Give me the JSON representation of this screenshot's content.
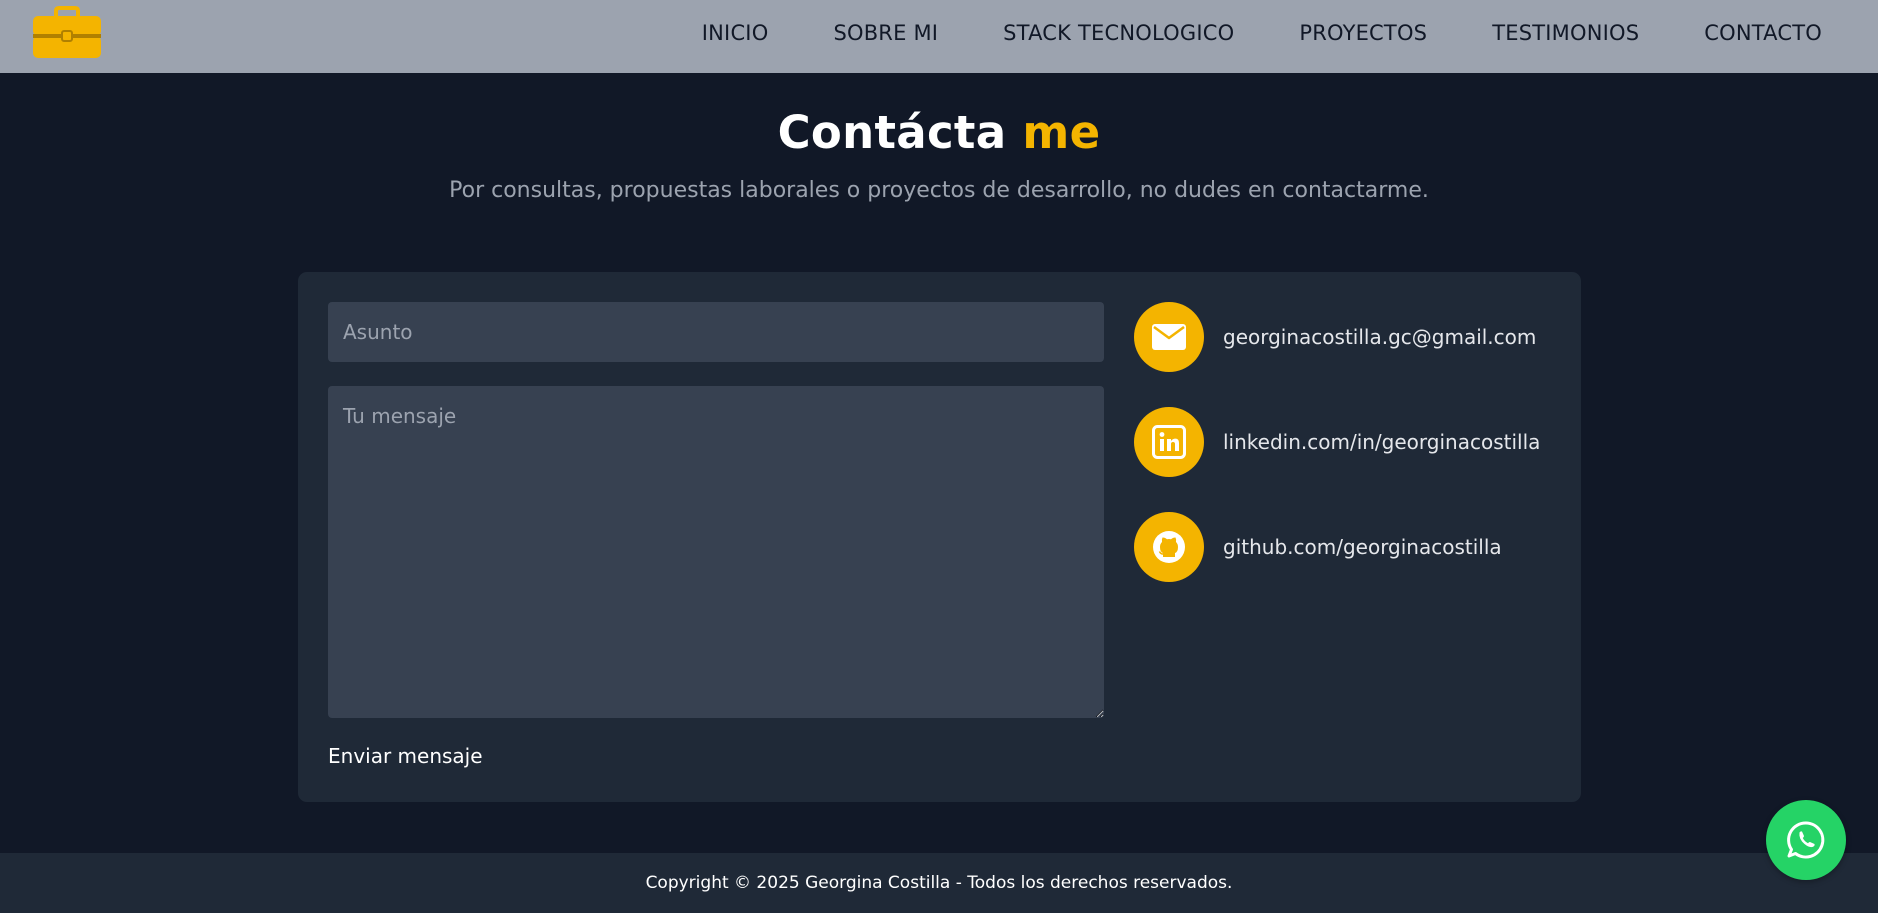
{
  "nav": {
    "items": [
      {
        "label": "INICIO"
      },
      {
        "label": "SOBRE MI"
      },
      {
        "label": "STACK TECNOLOGICO"
      },
      {
        "label": "PROYECTOS"
      },
      {
        "label": "TESTIMONIOS"
      },
      {
        "label": "CONTACTO"
      }
    ]
  },
  "header": {
    "title_main": "Contácta",
    "title_accent": "me",
    "subtitle": "Por consultas, propuestas laborales o proyectos de desarrollo, no dudes en contactarme."
  },
  "form": {
    "subject_placeholder": "Asunto",
    "subject_value": "",
    "message_placeholder": "Tu mensaje",
    "message_value": "",
    "send_label": "Enviar mensaje"
  },
  "contact": {
    "email": "georginacostilla.gc@gmail.com",
    "linkedin": "linkedin.com/in/georginacostilla",
    "github": "github.com/georginacostilla"
  },
  "footer": {
    "text": "Copyright © 2025 Georgina Costilla - Todos los derechos reservados."
  },
  "colors": {
    "accent": "#f4b400",
    "navbar_bg": "#9ca3af",
    "page_bg": "#111827",
    "card_bg": "#1f2937",
    "input_bg": "#374151",
    "whatsapp": "#25d366"
  },
  "icons": {
    "logo": "briefcase-icon",
    "email": "mail-icon",
    "linkedin": "linkedin-icon",
    "github": "github-icon",
    "whatsapp": "whatsapp-icon"
  }
}
